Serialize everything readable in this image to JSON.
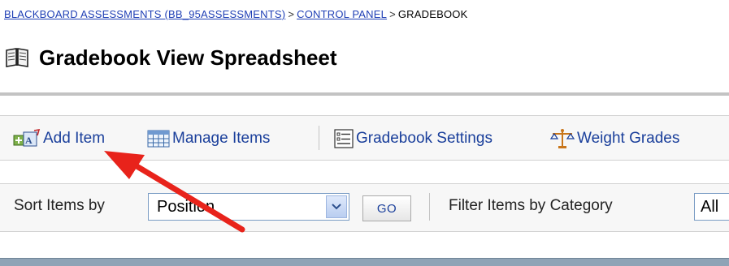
{
  "breadcrumb": {
    "course": "BLACKBOARD ASSESSMENTS (BB_95ASSESSMENTS)",
    "sep1": ">",
    "control_panel": "CONTROL PANEL",
    "sep2": ">",
    "current": "GRADEBOOK"
  },
  "page": {
    "title": "Gradebook View Spreadsheet",
    "title_icon": "book-icon"
  },
  "actions": {
    "add_item": {
      "label": "Add Item",
      "icon": "add-item-icon"
    },
    "manage_items": {
      "label": "Manage Items",
      "icon": "grid-icon"
    },
    "gradebook_settings": {
      "label": "Gradebook Settings",
      "icon": "settings-list-icon"
    },
    "weight_grades": {
      "label": "Weight Grades",
      "icon": "scale-icon"
    }
  },
  "sort": {
    "label": "Sort Items by",
    "selected": "Position",
    "go_label": "GO"
  },
  "filter": {
    "label": "Filter Items by Category",
    "selected": "All"
  },
  "colors": {
    "link": "#1a3f9b",
    "breadcrumb_link": "#1f3fb5",
    "annotation_arrow": "#e8231b",
    "rule": "#c3c3c3"
  }
}
